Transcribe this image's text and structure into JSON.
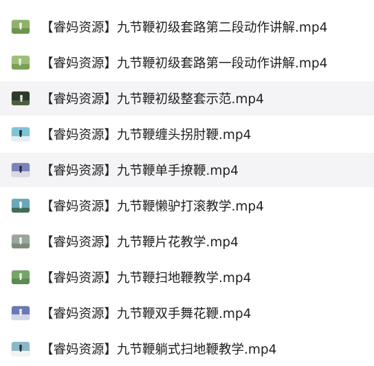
{
  "files": [
    {
      "name": "【睿妈资源】九节鞭初级套路第二段动作讲解.mp4",
      "thumb_icon": "video-thumbnail-icon",
      "thumb_bg": "#8fb36a",
      "thumb_fg": "#f2f2f2"
    },
    {
      "name": "【睿妈资源】九节鞭初级套路第一段动作讲解.mp4",
      "thumb_icon": "video-thumbnail-icon",
      "thumb_bg": "#9fbf78",
      "thumb_fg": "#eeeeee"
    },
    {
      "name": "【睿妈资源】九节鞭初级整套示范.mp4",
      "thumb_icon": "video-thumbnail-icon",
      "thumb_bg": "#2d3a2a",
      "thumb_fg": "#dfe7df"
    },
    {
      "name": "【睿妈资源】九节鞭缠头拐肘鞭.mp4",
      "thumb_icon": "video-thumbnail-icon",
      "thumb_bg": "#7fc4d6",
      "thumb_fg": "#1c2a33"
    },
    {
      "name": "【睿妈资源】九节鞭单手撩鞭.mp4",
      "thumb_icon": "video-thumbnail-icon",
      "thumb_bg": "#7a84b8",
      "thumb_fg": "#f3f3f3"
    },
    {
      "name": "【睿妈资源】九节鞭懒驴打滚教学.mp4",
      "thumb_icon": "video-thumbnail-icon",
      "thumb_bg": "#6aa7b8",
      "thumb_fg": "#f7f7f7"
    },
    {
      "name": "【睿妈资源】九节鞭片花教学.mp4",
      "thumb_icon": "video-thumbnail-icon",
      "thumb_bg": "#9aa79a",
      "thumb_fg": "#f2f2f2"
    },
    {
      "name": "【睿妈资源】九节鞭扫地鞭教学.mp4",
      "thumb_icon": "video-thumbnail-icon",
      "thumb_bg": "#74a56a",
      "thumb_fg": "#e9f0e9"
    },
    {
      "name": "【睿妈资源】九节鞭双手舞花鞭.mp4",
      "thumb_icon": "video-thumbnail-icon",
      "thumb_bg": "#6b79b4",
      "thumb_fg": "#f2f2f2"
    },
    {
      "name": "【睿妈资源】九节鞭躺式扫地鞭教学.mp4",
      "thumb_icon": "video-thumbnail-icon",
      "thumb_bg": "#8bb7c8",
      "thumb_fg": "#273238"
    }
  ],
  "colors": {
    "row_highlight": "#f4f4f6",
    "text": "#1f1f1f"
  }
}
